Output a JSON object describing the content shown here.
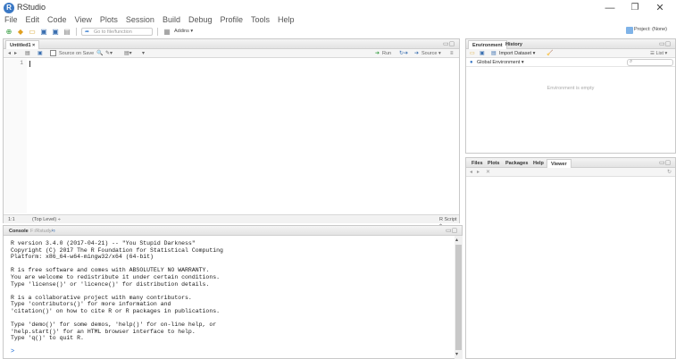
{
  "window": {
    "title": "RStudio",
    "minimize": "—",
    "maximize": "❐",
    "close": "✕"
  },
  "menu": [
    "File",
    "Edit",
    "Code",
    "View",
    "Plots",
    "Session",
    "Build",
    "Debug",
    "Profile",
    "Tools",
    "Help"
  ],
  "toolbar": {
    "goto_placeholder": "Go to file/function",
    "addins_label": "Addins ▾",
    "project_label": "Project: (None)"
  },
  "editor": {
    "tab_label": "Untitled1 ×",
    "source_on_save": "Source on Save",
    "run_label": "Run",
    "source_label": "Source ▾",
    "line_number": "1",
    "status_position": "1:1",
    "status_scope": "(Top Level) ÷",
    "status_type": "R Script ÷"
  },
  "console": {
    "tab_label": "Console",
    "path": "F:/Rstudy/",
    "lines": [
      "R version 3.4.0 (2017-04-21) -- \"You Stupid Darkness\"",
      "Copyright (C) 2017 The R Foundation for Statistical Computing",
      "Platform: x86_64-w64-mingw32/x64 (64-bit)",
      "",
      "R is free software and comes with ABSOLUTELY NO WARRANTY.",
      "You are welcome to redistribute it under certain conditions.",
      "Type 'license()' or 'licence()' for distribution details.",
      "",
      "R is a collaborative project with many contributors.",
      "Type 'contributors()' for more information and",
      "'citation()' on how to cite R or R packages in publications.",
      "",
      "Type 'demo()' for some demos, 'help()' for on-line help, or",
      "'help.start()' for an HTML browser interface to help.",
      "Type 'q()' to quit R."
    ],
    "prompt": ">"
  },
  "environment": {
    "tabs": [
      "Environment",
      "History"
    ],
    "import_dataset": "Import Dataset ▾",
    "list_label": "☰ List ▾",
    "scope": "Global Environment ▾",
    "empty_message": "Environment is empty"
  },
  "files": {
    "tabs": [
      "Files",
      "Plots",
      "Packages",
      "Help",
      "Viewer"
    ]
  }
}
